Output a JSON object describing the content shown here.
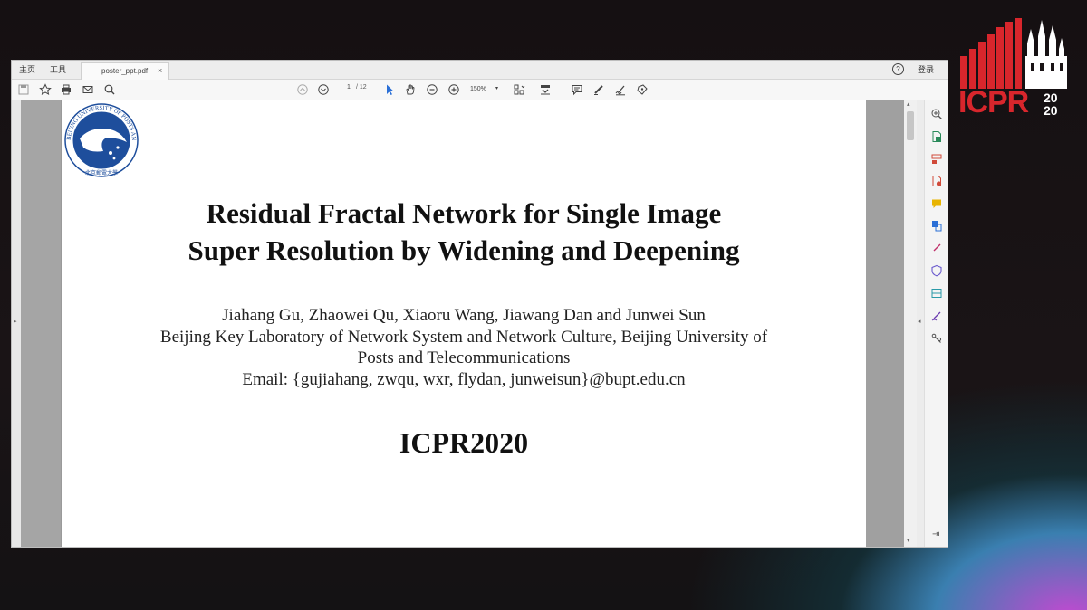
{
  "logo": {
    "text": "ICPR",
    "year_top": "20",
    "year_bottom": "20",
    "color": "#d8262c"
  },
  "app": {
    "menu": [
      "主页",
      "工具"
    ],
    "tab_name": "poster_ppt.pdf",
    "tab_close": "×",
    "help": "?",
    "login": "登录"
  },
  "toolbar": {
    "page_current": "1",
    "page_total": "/ 12",
    "zoom": "150%",
    "zoom_caret": "▾"
  },
  "scrollbar": {
    "up": "▴",
    "down": "▾"
  },
  "panels": {
    "left_arrow": "▸",
    "right_arrow": "◂",
    "collapse": "⇥"
  },
  "document": {
    "title_line1": "Residual Fractal Network for Single Image",
    "title_line2": "Super Resolution by Widening and Deepening",
    "authors": "Jiahang Gu, Zhaowei Qu, Xiaoru Wang, Jiawang Dan and Junwei Sun",
    "affiliation_line1": "Beijing Key Laboratory of Network System and Network Culture, Beijing University of",
    "affiliation_line2": "Posts and Telecommunications",
    "email": "Email:  {gujiahang, zwqu, wxr, flydan, junweisun}@bupt.edu.cn",
    "conference": "ICPR2020",
    "seal_text": "BEIJING UNIVERSITY OF POSTS AND TELECOMMUNICATIONS",
    "seal_text_cn": "北京郵電大學"
  },
  "colors": {
    "seal_blue": "#1e4e9c",
    "accent_blue": "#2a6fd6"
  }
}
